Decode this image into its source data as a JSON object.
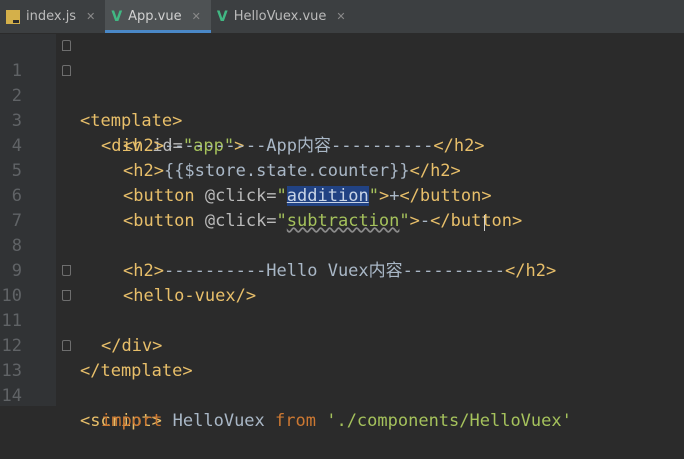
{
  "tabs": [
    {
      "label": "index.js",
      "icon": "js-file-icon"
    },
    {
      "label": "App.vue",
      "icon": "vue-file-icon",
      "active": true
    },
    {
      "label": "HelloVuex.vue",
      "icon": "vue-file-icon"
    }
  ],
  "lines": {
    "l1": {
      "num": "1",
      "a": "<template>"
    },
    "l2": {
      "num": "2",
      "a": "<div ",
      "b": "id=",
      "c": "\"app\"",
      "d": ">"
    },
    "l3": {
      "num": "3",
      "a": "<h2>",
      "b": "----------App内容----------",
      "c": "</h2>"
    },
    "l4": {
      "num": "4",
      "a": "<h2>",
      "b": "{{$store.state.counter}}",
      "c": "</h2>"
    },
    "l5": {
      "num": "5",
      "a": "<button ",
      "b": "@click=",
      "c": "\"",
      "d": "addition",
      "e": "\"",
      "f": ">",
      "g": "+",
      "h": "</button>"
    },
    "l6": {
      "num": "6",
      "a": "<button ",
      "b": "@click=",
      "c": "\"",
      "d": "subtraction",
      "e": "\"",
      "f": ">",
      "g": "-",
      "h": "</button>"
    },
    "l7": {
      "num": "7"
    },
    "l8": {
      "num": "8",
      "a": "<h2>",
      "b": "----------Hello Vuex内容----------",
      "c": "</h2>"
    },
    "l9": {
      "num": "9",
      "a": "<hello-vuex/>"
    },
    "l10": {
      "num": "10",
      "a": "</div>"
    },
    "l11": {
      "num": "11",
      "a": "</template>"
    },
    "l12": {
      "num": "12"
    },
    "l13": {
      "num": "13",
      "a": "<script>"
    },
    "l14": {
      "num": "14",
      "a": "import",
      "b": " HelloVuex ",
      "c": "from",
      "d": " ",
      "e": "'./components/HelloVuex'"
    }
  }
}
